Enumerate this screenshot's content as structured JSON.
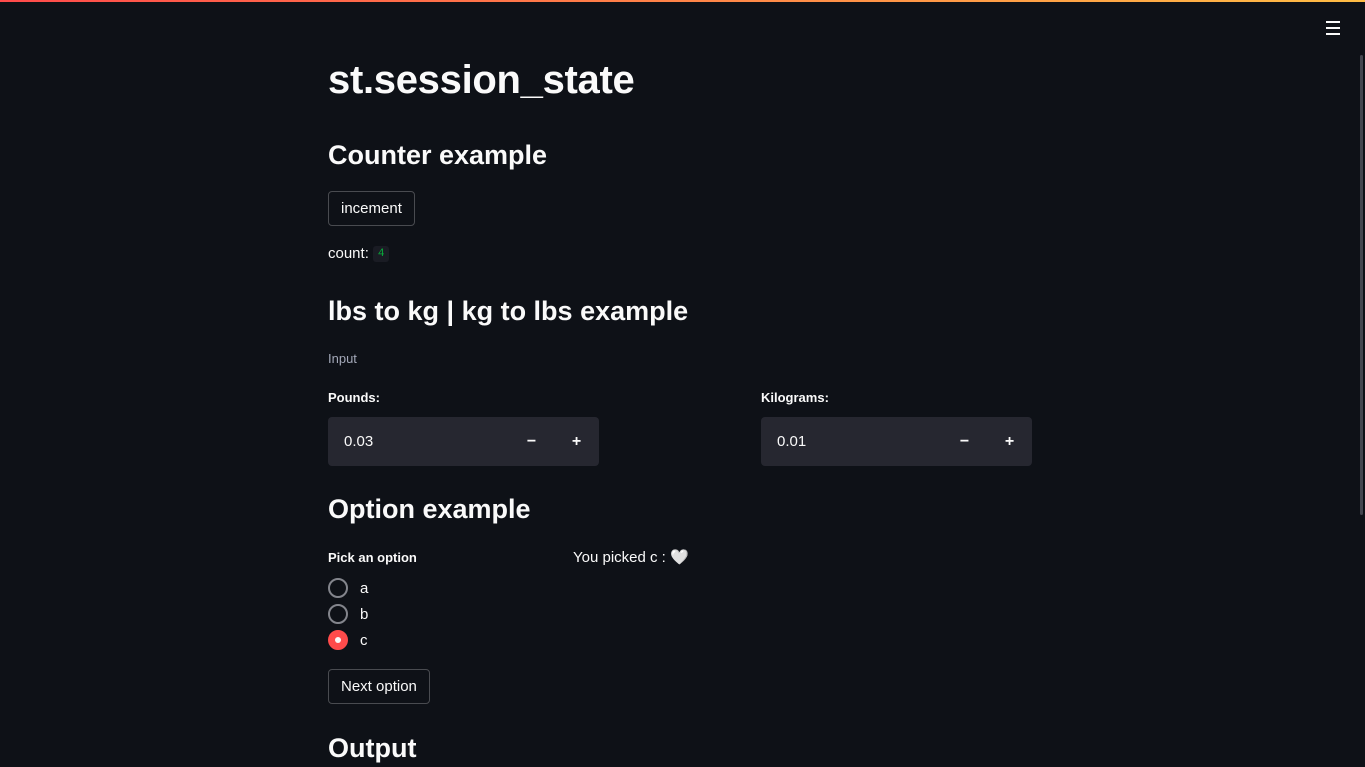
{
  "title": "st.session_state",
  "counter": {
    "heading": "Counter example",
    "button_label": "incement",
    "count_label": "count:",
    "count_value": "4"
  },
  "converter": {
    "heading": "lbs to kg | kg to lbs example",
    "caption": "Input",
    "pounds_label": "Pounds:",
    "pounds_value": "0.03",
    "kilograms_label": "Kilograms:",
    "kilograms_value": "0.01",
    "minus": "−",
    "plus": "+"
  },
  "options": {
    "heading": "Option example",
    "label": "Pick an option",
    "items": [
      "a",
      "b",
      "c"
    ],
    "selected": "c",
    "picked_text": "You picked c :",
    "picked_emoji": "🤍",
    "next_button": "Next option"
  },
  "output": {
    "heading": "Output"
  },
  "colors": {
    "background": "#0e1117",
    "accent": "#ff4b4b",
    "input_bg": "#262730",
    "code_green": "#09ab3b"
  }
}
